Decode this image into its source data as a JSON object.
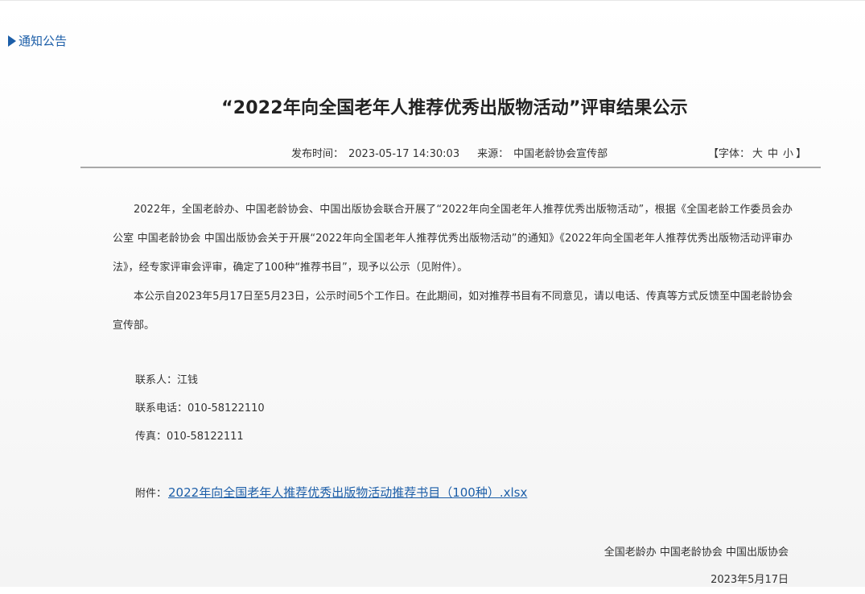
{
  "breadcrumb": {
    "label": "通知公告"
  },
  "article": {
    "title": "“2022年向全国老年人推荐优秀出版物活动”评审结果公示",
    "publish_label": "发布时间：",
    "publish_time": "2023-05-17 14:30:03",
    "source_label": "来源：",
    "source": "中国老龄协会宣传部",
    "font_size_control": {
      "prefix": "【字体：",
      "large": "大",
      "medium": "中",
      "small": "小",
      "suffix": "】"
    },
    "paragraphs": [
      "2022年，全国老龄办、中国老龄协会、中国出版协会联合开展了“2022年向全国老年人推荐优秀出版物活动”，根据《全国老龄工作委员会办公室 中国老龄协会 中国出版协会关于开展“2022年向全国老年人推荐优秀出版物活动”的通知》《2022年向全国老年人推荐优秀出版物活动评审办法》，经专家评审会评审，确定了100种“推荐书目”，现予以公示（见附件）。",
      "本公示自2023年5月17日至5月23日，公示时间5个工作日。在此期间，如对推荐书目有不同意见，请以电话、传真等方式反馈至中国老龄协会宣传部。"
    ],
    "contacts": {
      "person": "联系人：江钱",
      "phone": "联系电话：010-58122110",
      "fax": "传真：010-58122111"
    },
    "attachment": {
      "label": "附件：",
      "filename": "2022年向全国老年人推荐优秀出版物活动推荐书目（100种）.xlsx"
    },
    "signature": {
      "organizations": "全国老龄办 中国老龄协会 中国出版协会",
      "date": "2023年5月17日"
    }
  },
  "colors": {
    "link": "#1c5ea8",
    "text": "#333333",
    "divider": "#a9a9a9"
  }
}
